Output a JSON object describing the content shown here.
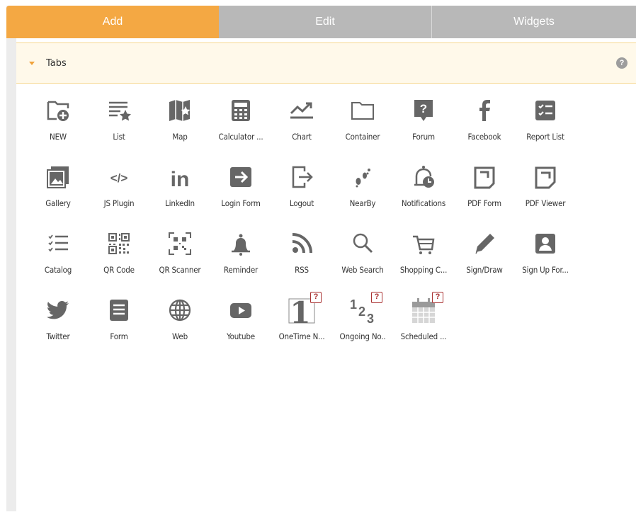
{
  "tabs": {
    "add": "Add",
    "edit": "Edit",
    "widgets": "Widgets"
  },
  "section": {
    "title": "Tabs",
    "help_icon_text": "?"
  },
  "items": [
    {
      "label": "NEW",
      "icon": "new-folder-icon"
    },
    {
      "label": "List",
      "icon": "list-star-icon"
    },
    {
      "label": "Map",
      "icon": "map-icon"
    },
    {
      "label": "Calculator ...",
      "icon": "calculator-icon"
    },
    {
      "label": "Chart",
      "icon": "chart-icon"
    },
    {
      "label": "Container",
      "icon": "folder-icon"
    },
    {
      "label": "Forum",
      "icon": "forum-icon"
    },
    {
      "label": "Facebook",
      "icon": "facebook-icon"
    },
    {
      "label": "Report List",
      "icon": "report-list-icon"
    },
    {
      "label": "Gallery",
      "icon": "gallery-icon"
    },
    {
      "label": "JS Plugin",
      "icon": "code-icon"
    },
    {
      "label": "LinkedIn",
      "icon": "linkedin-icon"
    },
    {
      "label": "Login Form",
      "icon": "login-icon"
    },
    {
      "label": "Logout",
      "icon": "logout-icon"
    },
    {
      "label": "NearBy",
      "icon": "footprints-icon"
    },
    {
      "label": "Notifications",
      "icon": "notification-bell-icon"
    },
    {
      "label": "PDF Form",
      "icon": "pdf-form-icon"
    },
    {
      "label": "PDF Viewer",
      "icon": "pdf-viewer-icon"
    },
    {
      "label": "Catalog",
      "icon": "catalog-icon"
    },
    {
      "label": "QR Code",
      "icon": "qr-code-icon"
    },
    {
      "label": "QR Scanner",
      "icon": "qr-scanner-icon"
    },
    {
      "label": "Reminder",
      "icon": "bell-icon"
    },
    {
      "label": "RSS",
      "icon": "rss-icon"
    },
    {
      "label": "Web Search",
      "icon": "search-icon"
    },
    {
      "label": "Shopping C...",
      "icon": "shopping-cart-icon"
    },
    {
      "label": "Sign/Draw",
      "icon": "pencil-icon"
    },
    {
      "label": "Sign Up For...",
      "icon": "signup-icon"
    },
    {
      "label": "Twitter",
      "icon": "twitter-icon"
    },
    {
      "label": "Form",
      "icon": "form-icon"
    },
    {
      "label": "Web",
      "icon": "globe-icon"
    },
    {
      "label": "Youtube",
      "icon": "youtube-icon"
    },
    {
      "label": "OneTime N...",
      "icon": "one-time-icon",
      "badge": "?"
    },
    {
      "label": "Ongoing No..",
      "icon": "ongoing-icon",
      "badge": "?"
    },
    {
      "label": "Scheduled ...",
      "icon": "scheduled-icon",
      "badge": "?"
    }
  ],
  "colors": {
    "active_tab": "#f4a843",
    "inactive_tab": "#b8b8b8",
    "icon": "#666666",
    "badge_border": "#aa3333"
  }
}
